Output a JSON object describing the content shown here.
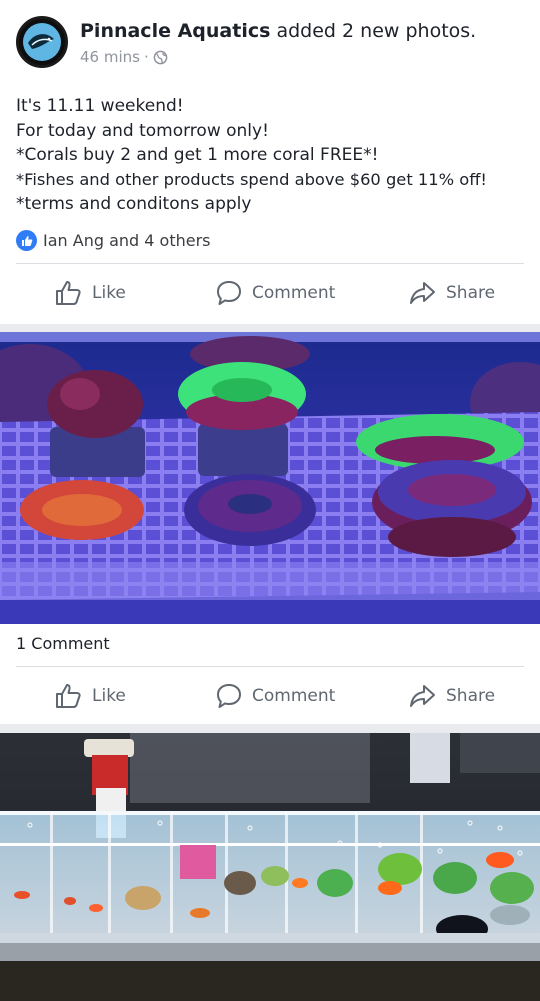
{
  "post": {
    "page_name": "Pinnacle Aquatics",
    "action_text": "added 2 new photos.",
    "time": "46 mins",
    "separator": "·",
    "text_lines": [
      "It's 11.11 weekend!",
      "For today and tomorrow only!",
      "*Corals buy 2 and get 1 more coral FREE*!",
      "*Fishes and other products spend above $60 get 11% off!",
      "*terms and conditons apply"
    ],
    "reactions": "Ian Ang and 4 others",
    "actions": {
      "like": "Like",
      "comment": "Comment",
      "share": "Share"
    }
  },
  "photo1_card": {
    "comment_count": "1 Comment",
    "actions": {
      "like": "Like",
      "comment": "Comment",
      "share": "Share"
    }
  },
  "icons": {
    "avatar": "fish-logo-icon",
    "globe": "globe-icon",
    "like_badge": "thumbs-up-badge-icon",
    "like": "thumbs-up-icon",
    "comment": "speech-bubble-icon",
    "share": "share-arrow-icon"
  },
  "colors": {
    "link_blue": "#2f7cf6",
    "secondary_text": "#90949c",
    "action_text": "#606770"
  }
}
